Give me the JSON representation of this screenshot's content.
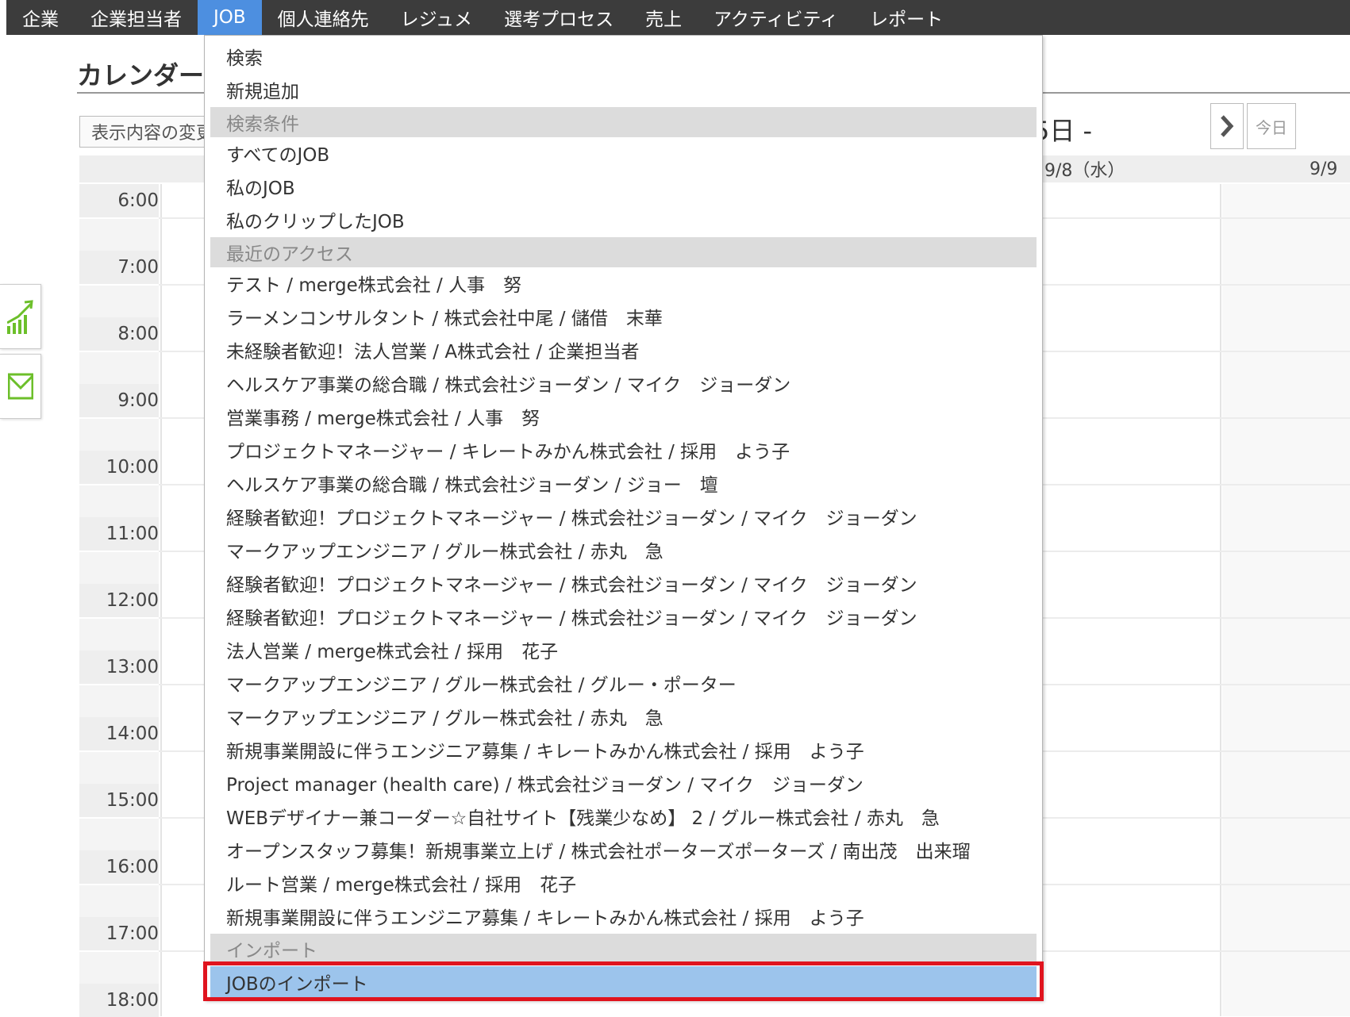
{
  "nav": {
    "items": [
      "企業",
      "企業担当者",
      "JOB",
      "個人連絡先",
      "レジュメ",
      "選考プロセス",
      "売上",
      "アクティビティ",
      "レポート"
    ],
    "active": "JOB"
  },
  "page": {
    "title": "カレンダー",
    "change_button": "表示内容の変更",
    "date_range": "5日 -",
    "today_button": "今日"
  },
  "calendar": {
    "day_headers": [
      "9/8（水）",
      "9/9"
    ],
    "hours": [
      "6:00",
      "7:00",
      "8:00",
      "9:00",
      "10:00",
      "11:00",
      "12:00",
      "13:00",
      "14:00",
      "15:00",
      "16:00",
      "17:00",
      "18:00"
    ]
  },
  "menu": {
    "search": "検索",
    "add_new": "新規追加",
    "section_conditions": "検索条件",
    "conditions": [
      "すべてのJOB",
      "私のJOB",
      "私のクリップしたJOB"
    ],
    "section_recent": "最近のアクセス",
    "recent": [
      "テスト / merge株式会社 / 人事　努",
      "ラーメンコンサルタント / 株式会社中尾 / 儲借　末華",
      "未経験者歓迎！法人営業 / A株式会社 / 企業担当者",
      "ヘルスケア事業の総合職 / 株式会社ジョーダン / マイク　ジョーダン",
      "営業事務 / merge株式会社 / 人事　努",
      "プロジェクトマネージャー / キレートみかん株式会社 / 採用　よう子",
      "ヘルスケア事業の総合職 / 株式会社ジョーダン / ジョー　壇",
      "経験者歓迎！プロジェクトマネージャー / 株式会社ジョーダン / マイク　ジョーダン",
      "マークアップエンジニア / グルー株式会社 / 赤丸　急",
      "経験者歓迎！プロジェクトマネージャー / 株式会社ジョーダン / マイク　ジョーダン",
      "経験者歓迎！プロジェクトマネージャー / 株式会社ジョーダン / マイク　ジョーダン",
      "法人営業 / merge株式会社 / 採用　花子",
      "マークアップエンジニア / グルー株式会社 / グルー・ポーター",
      "マークアップエンジニア / グルー株式会社 / 赤丸　急",
      "新規事業開設に伴うエンジニア募集 / キレートみかん株式会社 / 採用　よう子",
      "Project manager (health care) / 株式会社ジョーダン / マイク　ジョーダン",
      "WEBデザイナー兼コーダー☆自社サイト【残業少なめ】 2 / グルー株式会社 / 赤丸　急",
      "オープンスタッフ募集！新規事業立上げ / 株式会社ポーターズポーターズ / 南出茂　出来瑠",
      "ルート営業 / merge株式会社 / 採用　花子",
      "新規事業開設に伴うエンジニア募集 / キレートみかん株式会社 / 採用　よう子"
    ],
    "section_import": "インポート",
    "import_job": "JOBのインポート"
  },
  "colors": {
    "nav_bg": "#3c3c3c",
    "nav_active": "#4d8fe0",
    "menu_highlight": "#9cc4ec",
    "annotation_frame": "#e0141e",
    "icon_green": "#6cbf2a"
  },
  "icons": [
    "chart-icon",
    "mail-icon",
    "chevron-right-icon"
  ]
}
